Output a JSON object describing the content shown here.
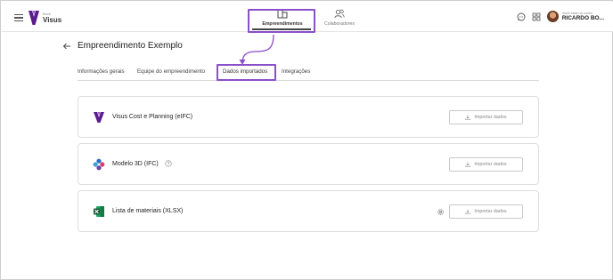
{
  "brand": {
    "small_label": "Brick",
    "name": "Visus"
  },
  "nav": {
    "tabs": [
      {
        "label": "Empreendimentos",
        "icon": "building-icon",
        "active": true
      },
      {
        "label": "Colaboradores",
        "icon": "users-icon",
        "active": false
      }
    ]
  },
  "user": {
    "caption": "Você está na conta",
    "name": "RICARDO BO..."
  },
  "page": {
    "title": "Empreendimento Exemplo"
  },
  "tabs": [
    {
      "label": "Informações gerais",
      "active": false
    },
    {
      "label": "Equipe do empreendimento",
      "active": false
    },
    {
      "label": "Dados importados",
      "active": true
    },
    {
      "label": "Integrações",
      "active": false
    }
  ],
  "cards": [
    {
      "title": "Visus Cost e Planning (eIFC)",
      "icon": "visus-logo-icon",
      "has_help": false,
      "has_settings": false,
      "button_label": "Importar dados"
    },
    {
      "title": "Modelo 3D (IFC)",
      "icon": "ifc-model-icon",
      "has_help": true,
      "has_settings": false,
      "button_label": "Importar dados"
    },
    {
      "title": "Lista de materiais (XLSX)",
      "icon": "excel-icon",
      "has_help": false,
      "has_settings": true,
      "button_label": "Importar dados"
    }
  ],
  "colors": {
    "highlight": "#8a4fc9",
    "brand": "#5b1c8c"
  }
}
